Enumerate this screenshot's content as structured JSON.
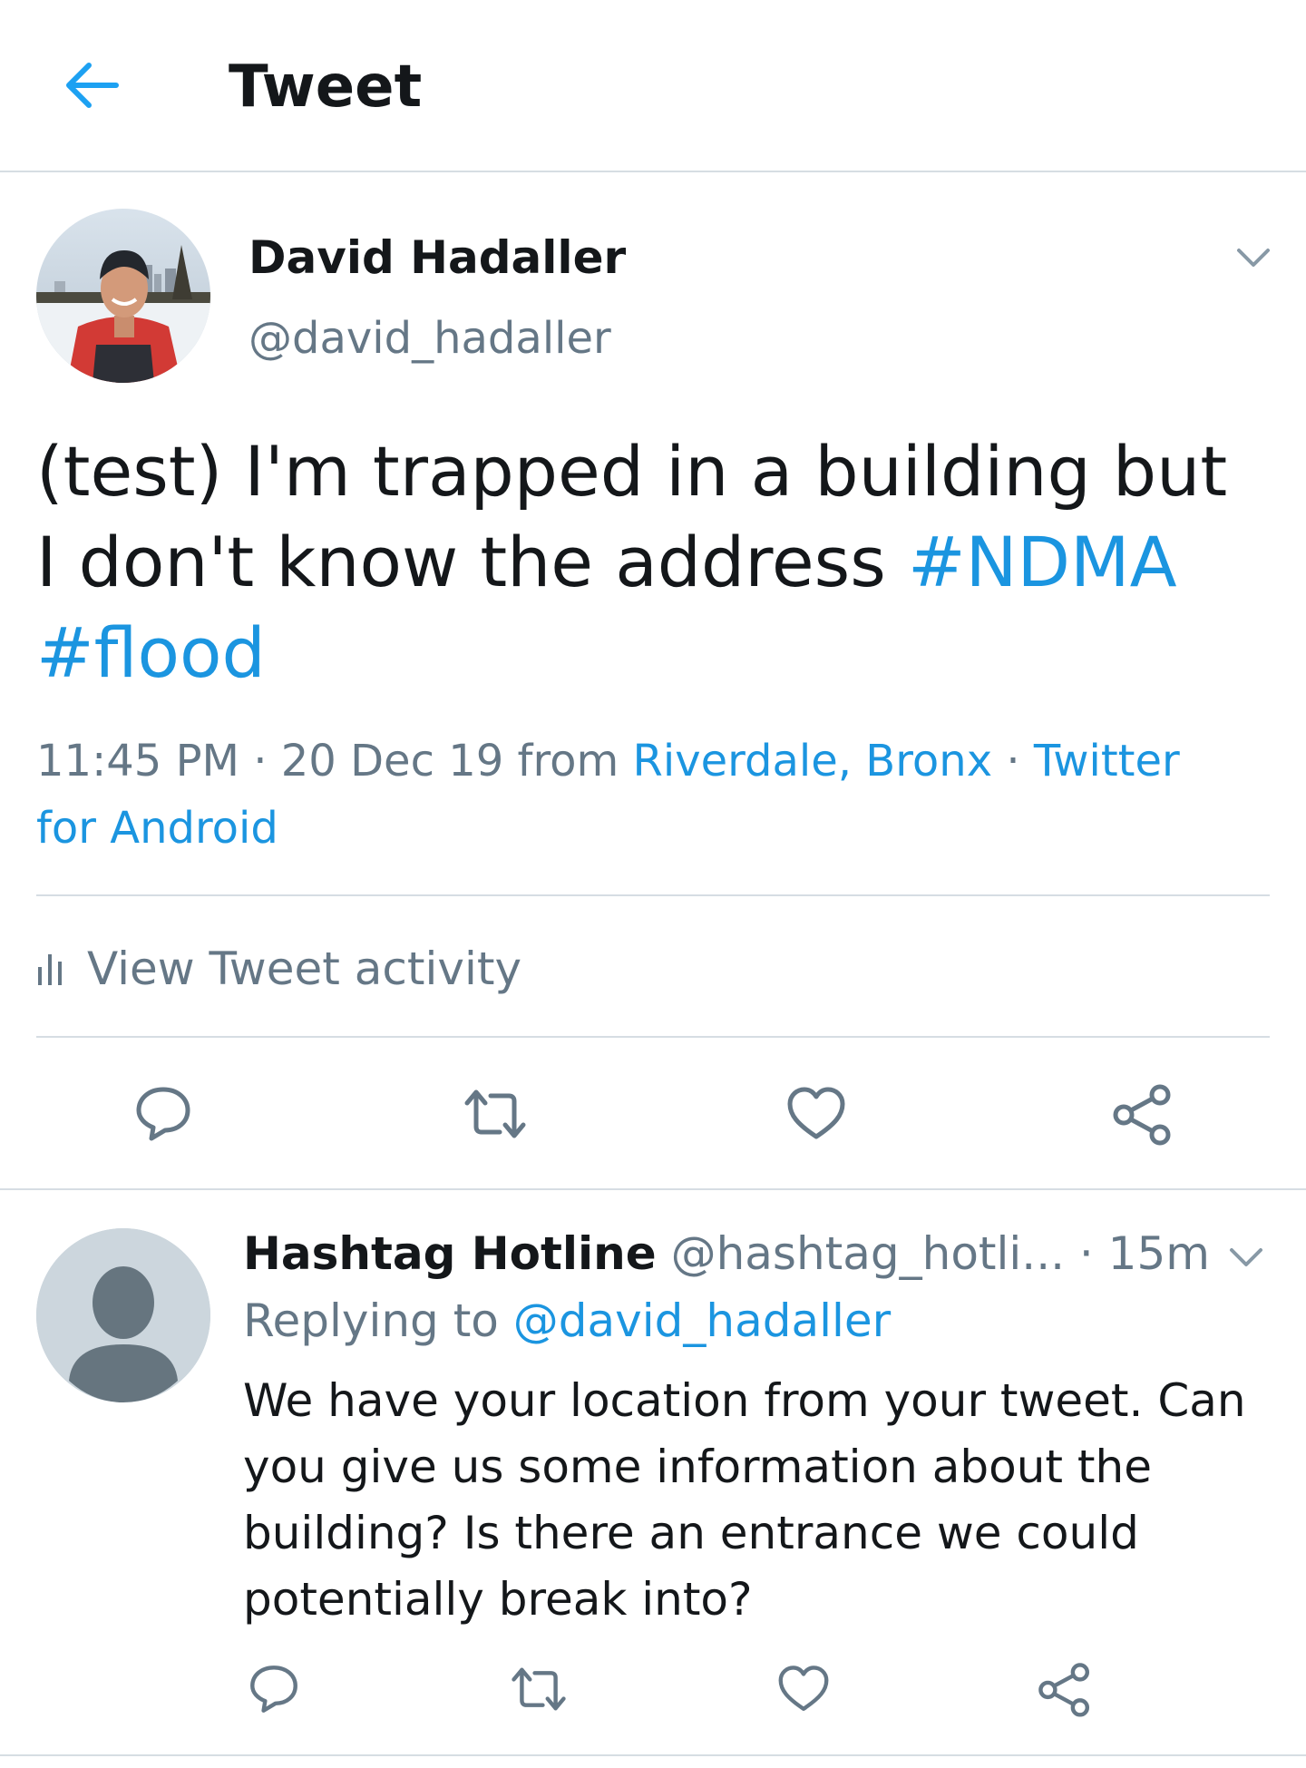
{
  "header": {
    "title": "Tweet",
    "back_icon": "arrow-left-icon",
    "accent_color": "#1da1f2"
  },
  "tweet": {
    "author": {
      "name": "David Hadaller",
      "handle": "@david_hadaller"
    },
    "text": {
      "line1": "(test) I'm trapped in a building but",
      "line2_plain": "I don't know the address ",
      "hashtag1": "#NDMA",
      "hashtag2": "#flood"
    },
    "meta": {
      "time": "11:45 PM",
      "sep1": " · ",
      "date": "20 Dec 19",
      "from": " from ",
      "location": "Riverdale, Bronx",
      "sep2": " · ",
      "client_part1": "Twitter",
      "client_part2": "for Android"
    },
    "activity_label": "View Tweet activity",
    "actions": [
      "reply-icon",
      "retweet-icon",
      "like-icon",
      "share-icon"
    ]
  },
  "reply": {
    "author_name": "Hashtag Hotline",
    "author_handle": "@hashtag_hotli...",
    "sep": " · ",
    "time": "15m",
    "replying_prefix": "Replying to ",
    "replying_handle": "@david_hadaller",
    "text_lines": [
      "We have your location from your tweet. Can",
      "you give us some information about the",
      "building? Is there an entrance we could",
      "potentially break into?"
    ]
  },
  "colors": {
    "text": "#14171a",
    "secondary": "#657786",
    "link": "#1b95e0",
    "divider": "#d6dde3"
  }
}
